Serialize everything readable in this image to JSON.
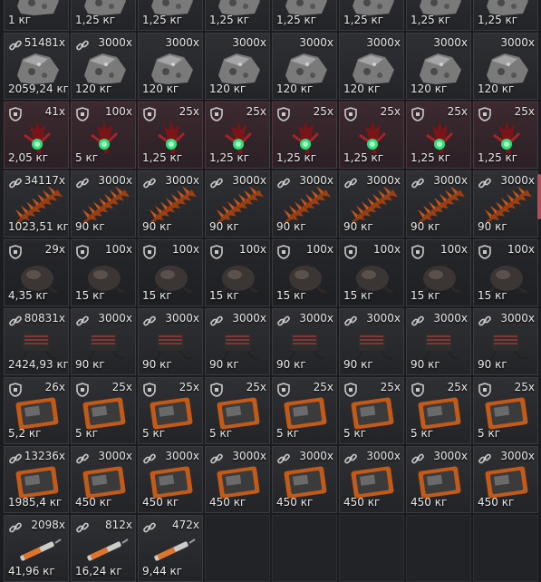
{
  "grid": {
    "columns": 8,
    "rows": [
      {
        "item": "ore-chunk",
        "cells": [
          {
            "count": "",
            "weight": "1 кг"
          },
          {
            "count": "",
            "weight": "1,25 кг"
          },
          {
            "count": "",
            "weight": "1,25 кг"
          },
          {
            "count": "",
            "weight": "1,25 кг"
          },
          {
            "count": "",
            "weight": "1,25 кг"
          },
          {
            "count": "",
            "weight": "1,25 кг"
          },
          {
            "count": "",
            "weight": "1,25 кг"
          },
          {
            "count": "",
            "weight": "1,25 кг"
          }
        ]
      },
      {
        "item": "ore-chunk",
        "cells": [
          {
            "icon": "link",
            "count": "51481x",
            "weight": "2059,24 кг"
          },
          {
            "icon": "link",
            "count": "3000x",
            "weight": "120 кг"
          },
          {
            "icon": "",
            "count": "3000x",
            "weight": "120 кг"
          },
          {
            "icon": "",
            "count": "3000x",
            "weight": "120 кг"
          },
          {
            "icon": "",
            "count": "3000x",
            "weight": "120 кг"
          },
          {
            "icon": "",
            "count": "3000x",
            "weight": "120 кг"
          },
          {
            "icon": "",
            "count": "3000x",
            "weight": "120 кг"
          },
          {
            "icon": "",
            "count": "3000x",
            "weight": "120 кг"
          }
        ]
      },
      {
        "item": "crystal-plant",
        "sel": true,
        "cells": [
          {
            "icon": "shield",
            "count": "41x",
            "weight": "2,05 кг"
          },
          {
            "icon": "shield",
            "count": "100x",
            "weight": "5 кг"
          },
          {
            "icon": "shield",
            "count": "25x",
            "weight": "1,25 кг"
          },
          {
            "icon": "shield",
            "count": "25x",
            "weight": "1,25 кг"
          },
          {
            "icon": "shield",
            "count": "25x",
            "weight": "1,25 кг"
          },
          {
            "icon": "shield",
            "count": "25x",
            "weight": "1,25 кг"
          },
          {
            "icon": "shield",
            "count": "25x",
            "weight": "1,25 кг"
          },
          {
            "icon": "shield",
            "count": "25x",
            "weight": "1,25 кг"
          }
        ]
      },
      {
        "item": "fern-leaf",
        "cells": [
          {
            "icon": "link",
            "count": "34117x",
            "weight": "1023,51 кг"
          },
          {
            "icon": "link",
            "count": "3000x",
            "weight": "90 кг"
          },
          {
            "icon": "link",
            "count": "3000x",
            "weight": "90 кг"
          },
          {
            "icon": "link",
            "count": "3000x",
            "weight": "90 кг"
          },
          {
            "icon": "link",
            "count": "3000x",
            "weight": "90 кг"
          },
          {
            "icon": "link",
            "count": "3000x",
            "weight": "90 кг"
          },
          {
            "icon": "link",
            "count": "3000x",
            "weight": "90 кг"
          },
          {
            "icon": "link",
            "count": "3000x",
            "weight": "90 кг"
          }
        ]
      },
      {
        "item": "gland",
        "dark": true,
        "cells": [
          {
            "icon": "shield",
            "count": "29x",
            "weight": "4,35 кг"
          },
          {
            "icon": "shield",
            "count": "100x",
            "weight": "15 кг"
          },
          {
            "icon": "shield",
            "count": "100x",
            "weight": "15 кг"
          },
          {
            "icon": "shield",
            "count": "100x",
            "weight": "15 кг"
          },
          {
            "icon": "shield",
            "count": "100x",
            "weight": "15 кг"
          },
          {
            "icon": "shield",
            "count": "100x",
            "weight": "15 кг"
          },
          {
            "icon": "shield",
            "count": "100x",
            "weight": "15 кг"
          },
          {
            "icon": "shield",
            "count": "100x",
            "weight": "15 кг"
          }
        ]
      },
      {
        "item": "pouch",
        "cells": [
          {
            "icon": "link",
            "count": "80831x",
            "weight": "2424,93 кг"
          },
          {
            "icon": "link",
            "count": "3000x",
            "weight": "90 кг"
          },
          {
            "icon": "link",
            "count": "3000x",
            "weight": "90 кг"
          },
          {
            "icon": "link",
            "count": "3000x",
            "weight": "90 кг"
          },
          {
            "icon": "link",
            "count": "3000x",
            "weight": "90 кг"
          },
          {
            "icon": "link",
            "count": "3000x",
            "weight": "90 кг"
          },
          {
            "icon": "link",
            "count": "3000x",
            "weight": "90 кг"
          },
          {
            "icon": "link",
            "count": "3000x",
            "weight": "90 кг"
          }
        ]
      },
      {
        "item": "tablet",
        "cells": [
          {
            "icon": "shield",
            "count": "26x",
            "weight": "5,2 кг"
          },
          {
            "icon": "shield",
            "count": "25x",
            "weight": "5 кг"
          },
          {
            "icon": "shield",
            "count": "25x",
            "weight": "5 кг"
          },
          {
            "icon": "shield",
            "count": "25x",
            "weight": "5 кг"
          },
          {
            "icon": "shield",
            "count": "25x",
            "weight": "5 кг"
          },
          {
            "icon": "shield",
            "count": "25x",
            "weight": "5 кг"
          },
          {
            "icon": "shield",
            "count": "25x",
            "weight": "5 кг"
          },
          {
            "icon": "shield",
            "count": "25x",
            "weight": "5 кг"
          }
        ]
      },
      {
        "item": "tablet",
        "cells": [
          {
            "icon": "link",
            "count": "13236x",
            "weight": "1985,4 кг"
          },
          {
            "icon": "link",
            "count": "3000x",
            "weight": "450 кг"
          },
          {
            "icon": "link",
            "count": "3000x",
            "weight": "450 кг"
          },
          {
            "icon": "link",
            "count": "3000x",
            "weight": "450 кг"
          },
          {
            "icon": "link",
            "count": "3000x",
            "weight": "450 кг"
          },
          {
            "icon": "link",
            "count": "3000x",
            "weight": "450 кг"
          },
          {
            "icon": "link",
            "count": "3000x",
            "weight": "450 кг"
          },
          {
            "icon": "link",
            "count": "3000x",
            "weight": "450 кг"
          }
        ]
      },
      {
        "item": "syringe",
        "cells": [
          {
            "icon": "link",
            "count": "2098x",
            "weight": "41,96 кг"
          },
          {
            "icon": "link",
            "count": "812x",
            "weight": "16,24 кг"
          },
          {
            "icon": "link",
            "count": "472x",
            "weight": "9,44 кг"
          },
          {
            "empty": true
          },
          {
            "empty": true
          },
          {
            "empty": true
          },
          {
            "empty": true
          },
          {
            "empty": true
          }
        ]
      }
    ]
  },
  "colors": {
    "count_text": "#e6e6e6",
    "weight_text": "#e9e9e9",
    "scroll_accent": "#b44d55"
  }
}
